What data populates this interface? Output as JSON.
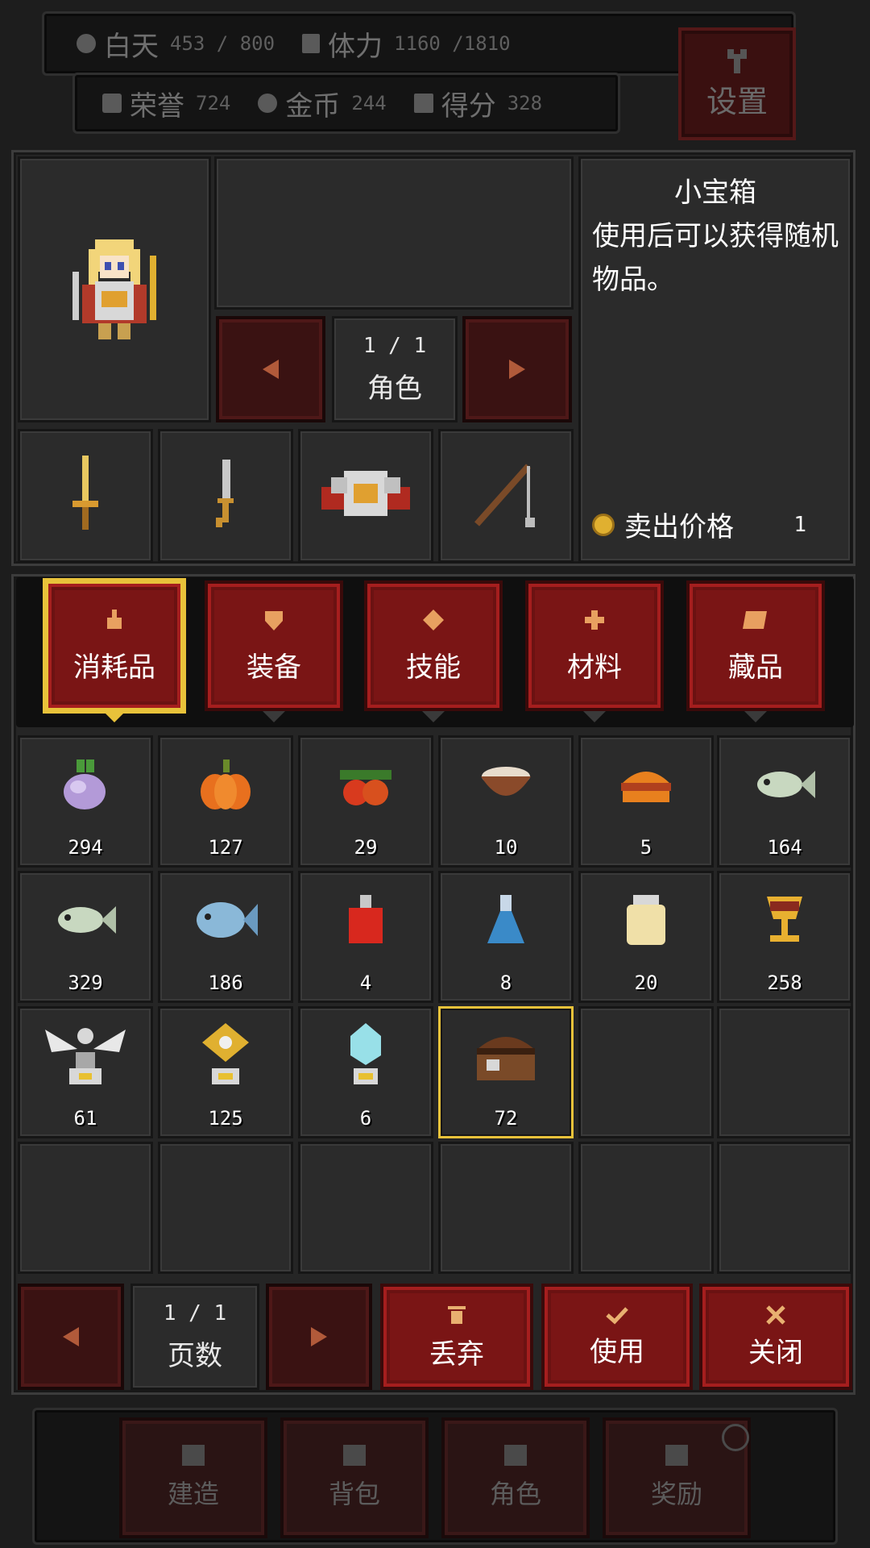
{
  "status": {
    "day_label": "白天",
    "day_value": "453 / 800",
    "stamina_label": "体力",
    "stamina_value": "1160 /1810",
    "honor_label": "荣誉",
    "honor_value": "724",
    "gold_label": "金币",
    "gold_value": "244",
    "score_label": "得分",
    "score_value": "328",
    "settings_label": "设置"
  },
  "character": {
    "page": "1 / 1",
    "label": "角色"
  },
  "detail": {
    "title": "小宝箱",
    "description": "使用后可以获得随机物品。",
    "sell_label": "卖出价格",
    "sell_value": "1"
  },
  "tabs": [
    {
      "label": "消耗品",
      "icon": "flask-icon",
      "selected": true
    },
    {
      "label": "装备",
      "icon": "shield-icon",
      "selected": false
    },
    {
      "label": "技能",
      "icon": "diamond-icon",
      "selected": false
    },
    {
      "label": "材料",
      "icon": "cross-icon",
      "selected": false
    },
    {
      "label": "藏品",
      "icon": "scroll-icon",
      "selected": false
    }
  ],
  "items": [
    {
      "icon": "turnip-icon",
      "count": "294"
    },
    {
      "icon": "pumpkin-icon",
      "count": "127"
    },
    {
      "icon": "berries-icon",
      "count": "29"
    },
    {
      "icon": "soup-bowl-icon",
      "count": "10"
    },
    {
      "icon": "burger-icon",
      "count": "5"
    },
    {
      "icon": "fish-icon",
      "count": "164"
    },
    {
      "icon": "fish-icon",
      "count": "329"
    },
    {
      "icon": "blue-fish-icon",
      "count": "186"
    },
    {
      "icon": "red-potion-icon",
      "count": "4"
    },
    {
      "icon": "blue-potion-icon",
      "count": "8"
    },
    {
      "icon": "jar-icon",
      "count": "20"
    },
    {
      "icon": "goblet-icon",
      "count": "258"
    },
    {
      "icon": "winged-totem-icon",
      "count": "61"
    },
    {
      "icon": "gold-gem-totem-icon",
      "count": "125"
    },
    {
      "icon": "crystal-totem-icon",
      "count": "6"
    },
    {
      "icon": "treasure-chest-icon",
      "count": "72"
    }
  ],
  "bottom": {
    "page": "1 / 1",
    "page_label": "页数",
    "discard_label": "丢弃",
    "use_label": "使用",
    "close_label": "关闭"
  },
  "nav": [
    {
      "label": "建造",
      "icon": "hammer-icon"
    },
    {
      "label": "背包",
      "icon": "bag-icon"
    },
    {
      "label": "角色",
      "icon": "character-icon"
    },
    {
      "label": "奖励",
      "icon": "reward-icon"
    }
  ],
  "colors": {
    "accent_red": "#7a1515",
    "selection_gold": "#e8c23a",
    "panel_bg": "#252525"
  }
}
